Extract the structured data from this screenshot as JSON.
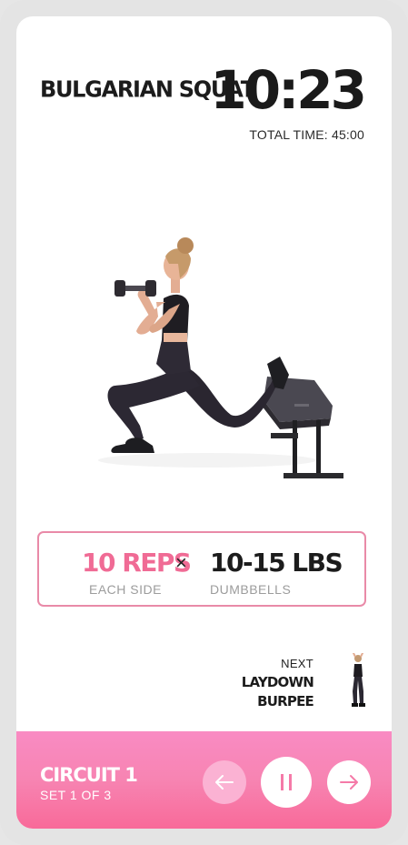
{
  "exercise": {
    "title": "BULGARIAN SQUAT",
    "timer": "10:23",
    "total_time": "TOTAL TIME: 45:00"
  },
  "reps": {
    "count": "10 REPS",
    "count_sub": "EACH SIDE",
    "times_symbol": "×",
    "weight": "10-15 LBS",
    "weight_sub": "DUMBBELLS"
  },
  "next": {
    "label": "NEXT",
    "name_line1": "LAYDOWN",
    "name_line2": "BURPEE"
  },
  "controls": {
    "circuit": "CIRCUIT 1",
    "set": "SET 1 OF 3",
    "prev_icon": "arrow-left-icon",
    "pause_icon": "pause-icon",
    "next_icon": "arrow-right-icon"
  },
  "colors": {
    "accent": "#f06b95",
    "bar_top": "#f98bc3",
    "bar_bottom": "#f86a99",
    "card_border": "#e98aa8"
  }
}
